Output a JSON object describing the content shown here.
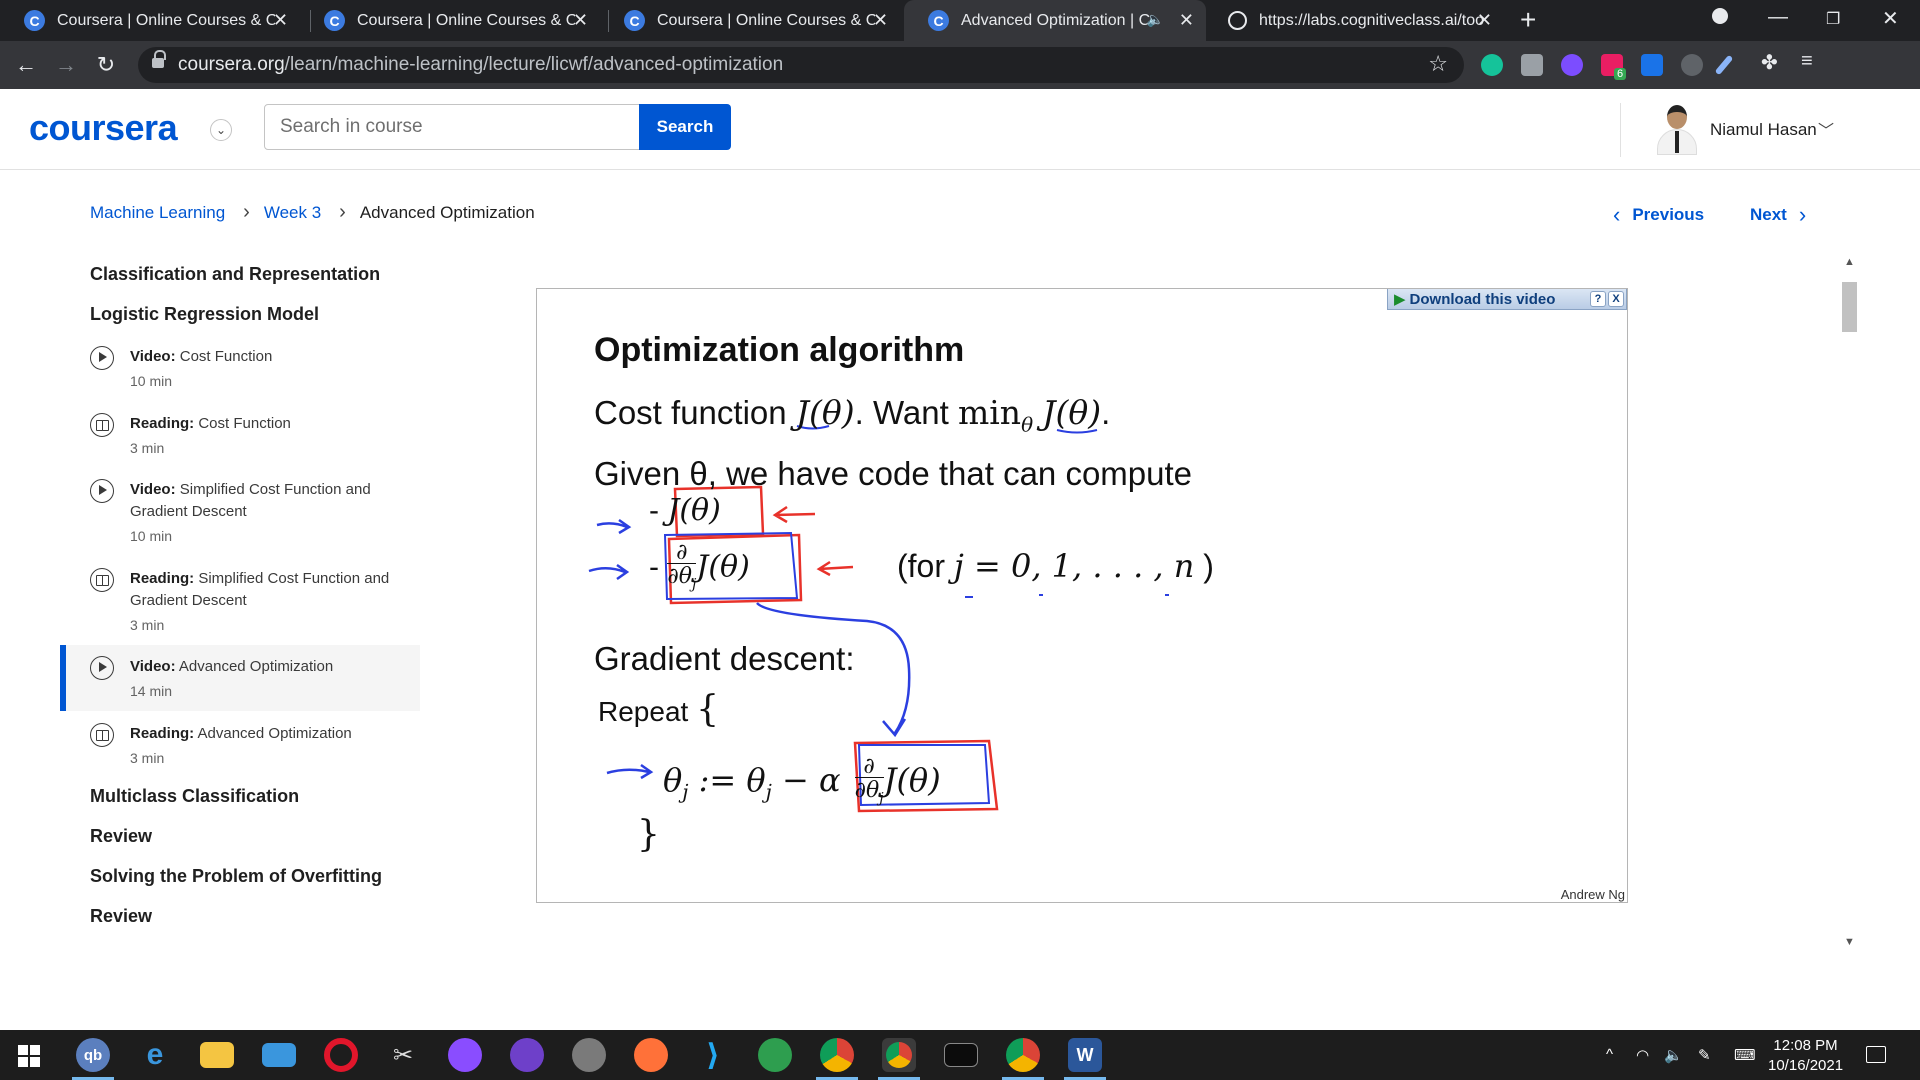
{
  "browser": {
    "tabs": [
      {
        "title": "Coursera | Online Courses & Credentials",
        "favicon": "C"
      },
      {
        "title": "Coursera | Online Courses & Credentials",
        "favicon": "C"
      },
      {
        "title": "Coursera | Online Courses & Credentials",
        "favicon": "C"
      },
      {
        "title": "Advanced Optimization | Coursera",
        "favicon": "C"
      },
      {
        "title": "https://labs.cognitiveclass.ai/tools",
        "favicon": ""
      }
    ],
    "new_tab": "+",
    "url_host": "coursera.org",
    "url_path": "/learn/machine-learning/lecture/licwf/advanced-optimization",
    "extension_badge": "6"
  },
  "header": {
    "logo": "coursera",
    "search_placeholder": "Search in course",
    "search_button": "Search",
    "user_name": "Niamul Hasan"
  },
  "breadcrumb": {
    "items": [
      "Machine Learning",
      "Week 3"
    ],
    "current": "Advanced Optimization"
  },
  "pager": {
    "previous": "Previous",
    "next": "Next"
  },
  "sidebar": {
    "sections_top": [
      "Classification and Representation",
      "Logistic Regression Model"
    ],
    "items": [
      {
        "type": "Video:",
        "title": "Cost Function",
        "duration": "10 min",
        "icon": "play-icon"
      },
      {
        "type": "Reading:",
        "title": "Cost Function",
        "duration": "3 min",
        "icon": "book-icon"
      },
      {
        "type": "Video:",
        "title": "Simplified Cost Function and Gradient Descent",
        "duration": "10 min",
        "icon": "play-icon"
      },
      {
        "type": "Reading:",
        "title": "Simplified Cost Function and Gradient Descent",
        "duration": "3 min",
        "icon": "book-icon"
      },
      {
        "type": "Video:",
        "title": "Advanced Optimization",
        "duration": "14 min",
        "icon": "play-icon"
      },
      {
        "type": "Reading:",
        "title": "Advanced Optimization",
        "duration": "3 min",
        "icon": "book-icon"
      }
    ],
    "sections_bottom": [
      "Multiclass Classification",
      "Review",
      "Solving the Problem of Overfitting",
      "Review"
    ]
  },
  "video": {
    "download_label": "Download this video",
    "help": "?",
    "close": "X",
    "slide": {
      "title": "Optimization algorithm",
      "line1_text": "Cost function",
      "line1_want": ". Want",
      "line2": "Given  θ, we have code that can compute",
      "for_text": "(for",
      "for_math": "j = 0, 1, . . . , n",
      "for_close": ")",
      "gd_title": "Gradient descent:",
      "repeat": "Repeat",
      "credit": "Andrew Ng"
    }
  },
  "taskbar": {
    "time": "12:08 PM",
    "date": "10/16/2021"
  },
  "colors": {
    "brand": "#0056d2",
    "chrome_dark": "#202124",
    "annotation_red": "#e8322a",
    "annotation_blue": "#2b3fe0"
  }
}
